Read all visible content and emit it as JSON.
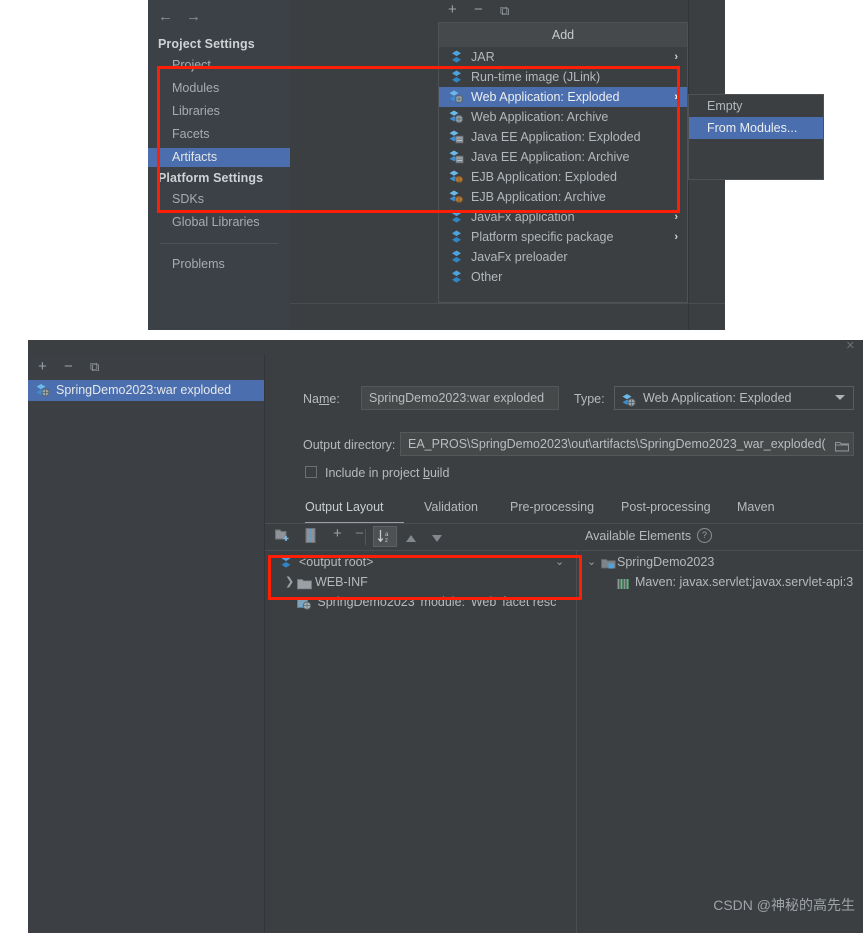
{
  "top_panel": {
    "nav": {
      "back_icon": "arrow-left-icon",
      "forward_icon": "arrow-right-icon",
      "back": "←",
      "forward": "→"
    },
    "sidebar": {
      "section_project": "Project Settings",
      "project_items": [
        "Project",
        "Modules",
        "Libraries",
        "Facets",
        "Artifacts"
      ],
      "section_platform": "Platform Settings",
      "platform_items": [
        "SDKs",
        "Global Libraries"
      ],
      "other_items": [
        "Problems"
      ],
      "selected": "Artifacts"
    },
    "toolbar": {
      "add": "+",
      "remove": "−",
      "copy": "⧉"
    },
    "add_menu": {
      "title": "Add",
      "items": [
        {
          "label": "JAR",
          "icon": "jar-icon",
          "submenu": true,
          "selected": false
        },
        {
          "label": "Run-time image (JLink)",
          "icon": "jlink-icon",
          "submenu": false,
          "selected": false
        },
        {
          "label": "Web Application: Exploded",
          "icon": "web-exploded-icon",
          "submenu": true,
          "selected": true
        },
        {
          "label": "Web Application: Archive",
          "icon": "web-archive-icon",
          "submenu": false,
          "selected": false
        },
        {
          "label": "Java EE Application: Exploded",
          "icon": "javaee-exploded-icon",
          "submenu": false,
          "selected": false
        },
        {
          "label": "Java EE Application: Archive",
          "icon": "javaee-archive-icon",
          "submenu": false,
          "selected": false
        },
        {
          "label": "EJB Application: Exploded",
          "icon": "ejb-exploded-icon",
          "submenu": false,
          "selected": false
        },
        {
          "label": "EJB Application: Archive",
          "icon": "ejb-archive-icon",
          "submenu": false,
          "selected": false
        },
        {
          "label": "JavaFx application",
          "icon": "javafx-icon",
          "submenu": true,
          "selected": false
        },
        {
          "label": "Platform specific package",
          "icon": "platform-package-icon",
          "submenu": true,
          "selected": false
        },
        {
          "label": "JavaFx preloader",
          "icon": "javafx-preloader-icon",
          "submenu": false,
          "selected": false
        },
        {
          "label": "Other",
          "icon": "other-icon",
          "submenu": false,
          "selected": false
        }
      ],
      "submenu_arrow": "›"
    },
    "sub_menu": {
      "items": [
        {
          "label": "Empty",
          "selected": false
        },
        {
          "label": "From Modules...",
          "selected": true
        }
      ]
    }
  },
  "bottom_panel": {
    "close_icon": "close-icon",
    "toolbar": {
      "add": "+",
      "remove": "−",
      "copy": "⧉"
    },
    "artifact_list": [
      {
        "label": "SpringDemo2023:war exploded",
        "icon": "web-exploded-icon",
        "selected": true
      }
    ],
    "name_label": "Name:",
    "name_label_parts": {
      "pre": "Na",
      "underlined": "m",
      "post": "e:"
    },
    "name_value": "SpringDemo2023:war exploded",
    "type_label": "Type:",
    "type_value": "Web Application: Exploded",
    "type_icon": "web-exploded-icon",
    "type_caret_icon": "chevron-down-icon",
    "output_dir_label": "Output directory:",
    "output_dir_value": ")EA_PROS\\SpringDemo2023\\out\\artifacts\\SpringDemo2023_war_exploded",
    "output_dir_browse_icon": "folder-browse-icon",
    "include_in_build": {
      "label_pre": "Include in project ",
      "label_underlined": "b",
      "label_post": "uild",
      "checked": false
    },
    "tabs": [
      {
        "label": "Output Layout",
        "active": true
      },
      {
        "label": "Validation",
        "active": false
      },
      {
        "label": "Pre-processing",
        "active": false
      },
      {
        "label": "Post-processing",
        "active": false
      },
      {
        "label": "Maven",
        "active": false
      }
    ],
    "layout_toolbar": {
      "icons": [
        "create-directory-icon",
        "create-archive-icon",
        "add-copy-icon",
        "remove-icon",
        "sort-az-icon",
        "move-up-icon",
        "move-down-icon"
      ],
      "sort_active": true
    },
    "available_elements_label": "Available Elements",
    "available_help_icon": "help-icon",
    "output_tree": [
      {
        "label": "<output root>",
        "icon": "artifact-root-icon",
        "depth": 0,
        "twisty": "none"
      },
      {
        "label": "WEB-INF",
        "icon": "folder-icon",
        "depth": 1,
        "twisty": "collapsed"
      },
      {
        "label": "'SpringDemo2023' module: 'Web' facet resc",
        "icon": "web-facet-icon",
        "depth": 1,
        "twisty": "none"
      }
    ],
    "output_collapse_icon": "chevron-down-icon",
    "available_tree": [
      {
        "label": "SpringDemo2023",
        "icon": "module-icon",
        "depth": 0,
        "twisty": "expanded"
      },
      {
        "label": "Maven: javax.servlet:javax.servlet-api:3",
        "icon": "library-icon",
        "depth": 1,
        "twisty": "none"
      }
    ]
  },
  "annotations": {
    "highlight_color": "#fe1f06",
    "rect_labels": [
      "artifacts-add-web-application-exploded-highlight",
      "output-layout-web-inf-highlight"
    ]
  },
  "watermark": "CSDN @神秘的高先生"
}
